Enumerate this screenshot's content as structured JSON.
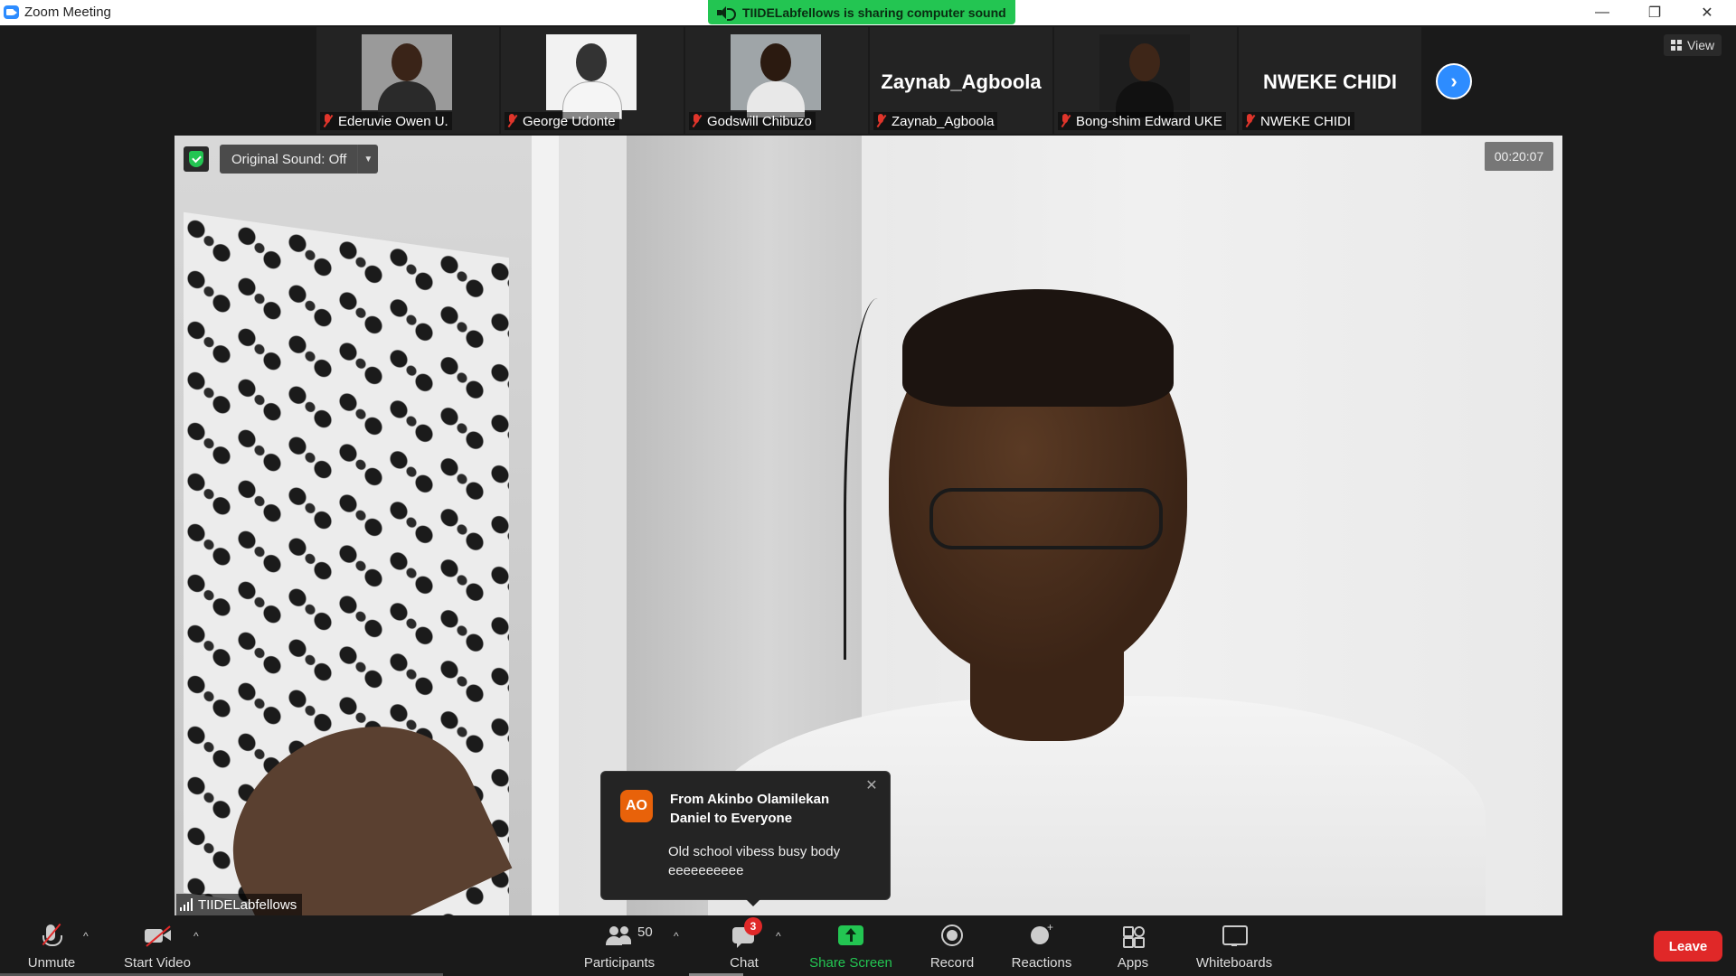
{
  "window": {
    "title": "Zoom Meeting"
  },
  "banner": {
    "text": "TIIDELabfellows is sharing computer sound"
  },
  "thumbnails": [
    {
      "name": "Ederuvie Owen U.",
      "has_photo": true
    },
    {
      "name": "George Udonte",
      "has_photo": true
    },
    {
      "name": "Godswill Chibuzo",
      "has_photo": true
    },
    {
      "name": "Zaynab_Agboola",
      "display_name": "Zaynab_Agboola",
      "has_photo": false
    },
    {
      "name": "Bong-shim Edward UKE",
      "has_photo": true
    },
    {
      "name": "NWEKE CHIDI",
      "display_name": "NWEKE CHIDI",
      "has_photo": false
    }
  ],
  "view": {
    "label": "View"
  },
  "video": {
    "original_sound": "Original Sound: Off",
    "timer": "00:20:07",
    "speaker_name": "TIIDELabfellows"
  },
  "chat_popup": {
    "avatar_initials": "AO",
    "from": "From Akinbo Olamilekan Daniel to Everyone",
    "message": "Old school vibess busy body eeeeeeeeee"
  },
  "toolbar": {
    "unmute": "Unmute",
    "start_video": "Start Video",
    "participants": "Participants",
    "participants_count": "50",
    "chat": "Chat",
    "chat_badge": "3",
    "share_screen": "Share Screen",
    "record": "Record",
    "reactions": "Reactions",
    "apps": "Apps",
    "whiteboards": "Whiteboards",
    "leave": "Leave"
  },
  "colors": {
    "zoom_blue": "#2d8cff",
    "share_green": "#23c552",
    "leave_red": "#e02828",
    "avatar_orange": "#e8620a"
  }
}
